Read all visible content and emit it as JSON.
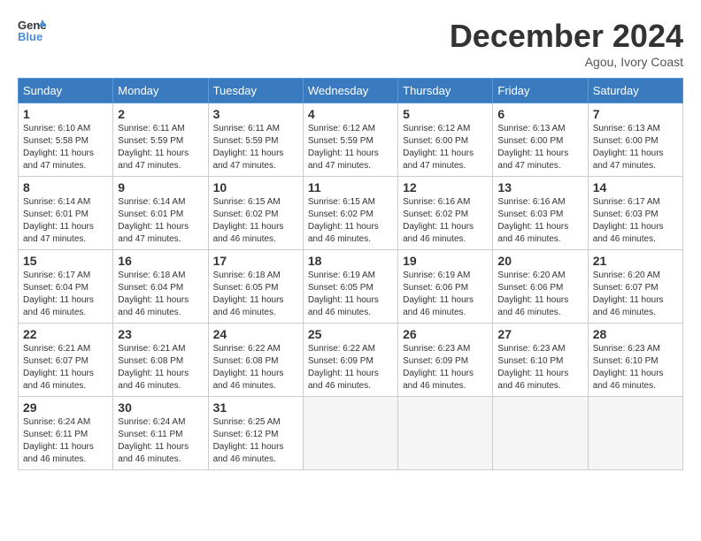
{
  "header": {
    "logo_line1": "General",
    "logo_line2": "Blue",
    "month_title": "December 2024",
    "location": "Agou, Ivory Coast"
  },
  "weekdays": [
    "Sunday",
    "Monday",
    "Tuesday",
    "Wednesday",
    "Thursday",
    "Friday",
    "Saturday"
  ],
  "weeks": [
    [
      {
        "day": "1",
        "info": "Sunrise: 6:10 AM\nSunset: 5:58 PM\nDaylight: 11 hours\nand 47 minutes."
      },
      {
        "day": "2",
        "info": "Sunrise: 6:11 AM\nSunset: 5:59 PM\nDaylight: 11 hours\nand 47 minutes."
      },
      {
        "day": "3",
        "info": "Sunrise: 6:11 AM\nSunset: 5:59 PM\nDaylight: 11 hours\nand 47 minutes."
      },
      {
        "day": "4",
        "info": "Sunrise: 6:12 AM\nSunset: 5:59 PM\nDaylight: 11 hours\nand 47 minutes."
      },
      {
        "day": "5",
        "info": "Sunrise: 6:12 AM\nSunset: 6:00 PM\nDaylight: 11 hours\nand 47 minutes."
      },
      {
        "day": "6",
        "info": "Sunrise: 6:13 AM\nSunset: 6:00 PM\nDaylight: 11 hours\nand 47 minutes."
      },
      {
        "day": "7",
        "info": "Sunrise: 6:13 AM\nSunset: 6:00 PM\nDaylight: 11 hours\nand 47 minutes."
      }
    ],
    [
      {
        "day": "8",
        "info": "Sunrise: 6:14 AM\nSunset: 6:01 PM\nDaylight: 11 hours\nand 47 minutes."
      },
      {
        "day": "9",
        "info": "Sunrise: 6:14 AM\nSunset: 6:01 PM\nDaylight: 11 hours\nand 47 minutes."
      },
      {
        "day": "10",
        "info": "Sunrise: 6:15 AM\nSunset: 6:02 PM\nDaylight: 11 hours\nand 46 minutes."
      },
      {
        "day": "11",
        "info": "Sunrise: 6:15 AM\nSunset: 6:02 PM\nDaylight: 11 hours\nand 46 minutes."
      },
      {
        "day": "12",
        "info": "Sunrise: 6:16 AM\nSunset: 6:02 PM\nDaylight: 11 hours\nand 46 minutes."
      },
      {
        "day": "13",
        "info": "Sunrise: 6:16 AM\nSunset: 6:03 PM\nDaylight: 11 hours\nand 46 minutes."
      },
      {
        "day": "14",
        "info": "Sunrise: 6:17 AM\nSunset: 6:03 PM\nDaylight: 11 hours\nand 46 minutes."
      }
    ],
    [
      {
        "day": "15",
        "info": "Sunrise: 6:17 AM\nSunset: 6:04 PM\nDaylight: 11 hours\nand 46 minutes."
      },
      {
        "day": "16",
        "info": "Sunrise: 6:18 AM\nSunset: 6:04 PM\nDaylight: 11 hours\nand 46 minutes."
      },
      {
        "day": "17",
        "info": "Sunrise: 6:18 AM\nSunset: 6:05 PM\nDaylight: 11 hours\nand 46 minutes."
      },
      {
        "day": "18",
        "info": "Sunrise: 6:19 AM\nSunset: 6:05 PM\nDaylight: 11 hours\nand 46 minutes."
      },
      {
        "day": "19",
        "info": "Sunrise: 6:19 AM\nSunset: 6:06 PM\nDaylight: 11 hours\nand 46 minutes."
      },
      {
        "day": "20",
        "info": "Sunrise: 6:20 AM\nSunset: 6:06 PM\nDaylight: 11 hours\nand 46 minutes."
      },
      {
        "day": "21",
        "info": "Sunrise: 6:20 AM\nSunset: 6:07 PM\nDaylight: 11 hours\nand 46 minutes."
      }
    ],
    [
      {
        "day": "22",
        "info": "Sunrise: 6:21 AM\nSunset: 6:07 PM\nDaylight: 11 hours\nand 46 minutes."
      },
      {
        "day": "23",
        "info": "Sunrise: 6:21 AM\nSunset: 6:08 PM\nDaylight: 11 hours\nand 46 minutes."
      },
      {
        "day": "24",
        "info": "Sunrise: 6:22 AM\nSunset: 6:08 PM\nDaylight: 11 hours\nand 46 minutes."
      },
      {
        "day": "25",
        "info": "Sunrise: 6:22 AM\nSunset: 6:09 PM\nDaylight: 11 hours\nand 46 minutes."
      },
      {
        "day": "26",
        "info": "Sunrise: 6:23 AM\nSunset: 6:09 PM\nDaylight: 11 hours\nand 46 minutes."
      },
      {
        "day": "27",
        "info": "Sunrise: 6:23 AM\nSunset: 6:10 PM\nDaylight: 11 hours\nand 46 minutes."
      },
      {
        "day": "28",
        "info": "Sunrise: 6:23 AM\nSunset: 6:10 PM\nDaylight: 11 hours\nand 46 minutes."
      }
    ],
    [
      {
        "day": "29",
        "info": "Sunrise: 6:24 AM\nSunset: 6:11 PM\nDaylight: 11 hours\nand 46 minutes."
      },
      {
        "day": "30",
        "info": "Sunrise: 6:24 AM\nSunset: 6:11 PM\nDaylight: 11 hours\nand 46 minutes."
      },
      {
        "day": "31",
        "info": "Sunrise: 6:25 AM\nSunset: 6:12 PM\nDaylight: 11 hours\nand 46 minutes."
      },
      {
        "day": "",
        "info": ""
      },
      {
        "day": "",
        "info": ""
      },
      {
        "day": "",
        "info": ""
      },
      {
        "day": "",
        "info": ""
      }
    ]
  ]
}
